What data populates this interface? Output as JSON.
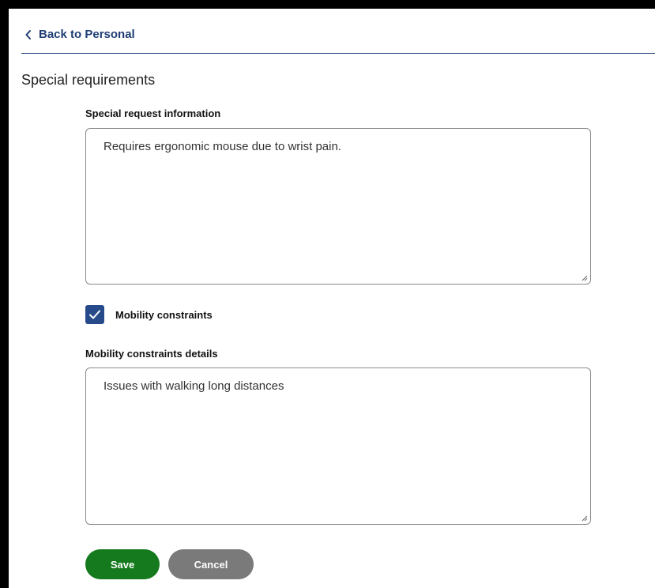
{
  "nav": {
    "back_label": "Back to Personal"
  },
  "section": {
    "title": "Special requirements"
  },
  "special_request": {
    "label": "Special request information",
    "value": "Requires ergonomic mouse due to wrist pain."
  },
  "mobility": {
    "checkbox_label": "Mobility constraints",
    "checked": true,
    "details_label": "Mobility constraints details",
    "details_value": "Issues with walking long distances"
  },
  "actions": {
    "save_label": "Save",
    "cancel_label": "Cancel"
  },
  "colors": {
    "link": "#1f3d73",
    "checkbox": "#274b8a",
    "save": "#157a1e",
    "cancel": "#7a7a7a"
  }
}
